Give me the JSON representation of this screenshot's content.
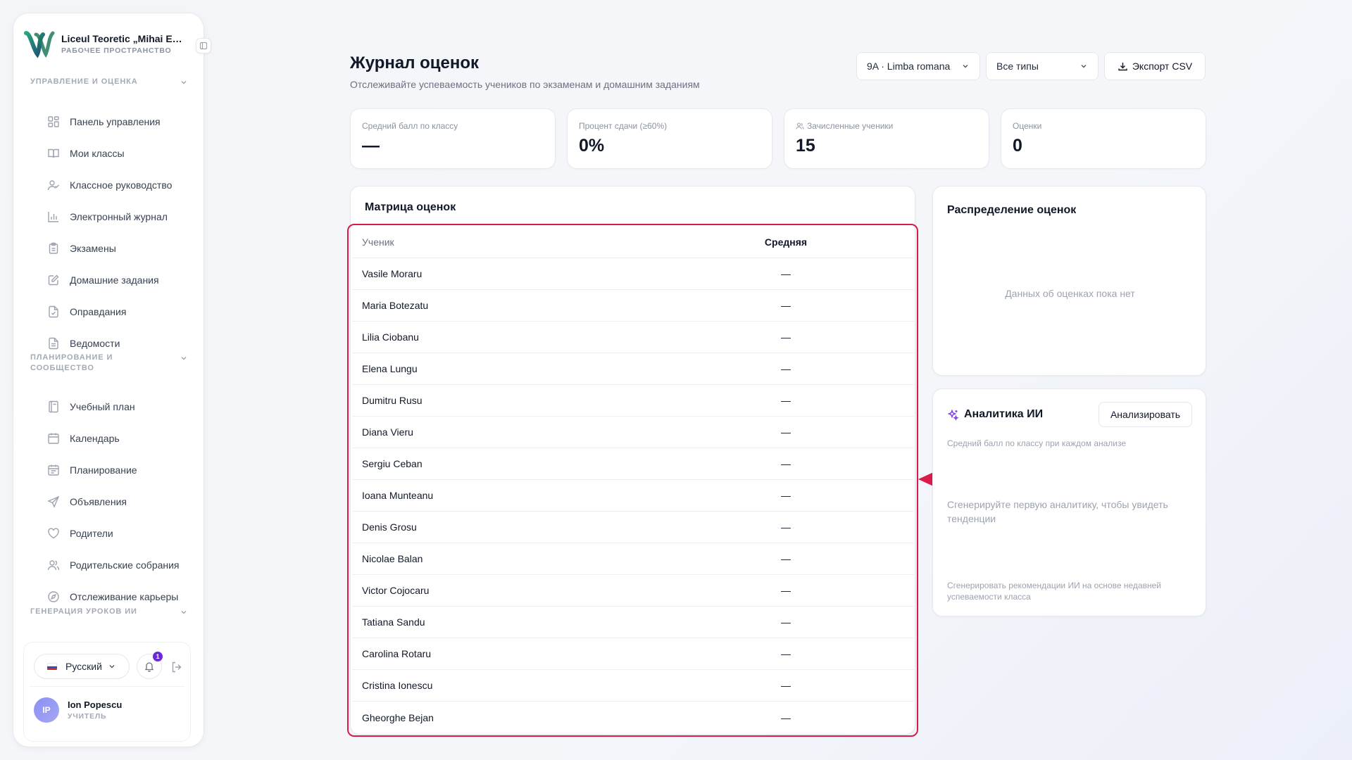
{
  "sidebar": {
    "school_name": "Liceul Teoretic „Mihai Emi...",
    "workspace_label": "РАБОЧЕЕ ПРОСТРАНСТВО",
    "sections": [
      {
        "title": "УПРАВЛЕНИЕ И ОЦЕНКА"
      },
      {
        "title": "ПЛАНИРОВАНИЕ И СООБЩЕСТВО"
      },
      {
        "title": "ГЕНЕРАЦИЯ УРОКОВ ИИ"
      }
    ],
    "items": [
      {
        "label": "Панель управления",
        "icon": "grid-icon"
      },
      {
        "label": "Мои классы",
        "icon": "book-open-icon"
      },
      {
        "label": "Классное руководство",
        "icon": "user-check-icon"
      },
      {
        "label": "Электронный журнал",
        "icon": "bar-chart-icon"
      },
      {
        "label": "Экзамены",
        "icon": "clipboard-icon"
      },
      {
        "label": "Домашние задания",
        "icon": "edit-icon"
      },
      {
        "label": "Оправдания",
        "icon": "file-check-icon"
      },
      {
        "label": "Ведомости",
        "icon": "file-text-icon"
      },
      {
        "label": "Учебный план",
        "icon": "notebook-icon"
      },
      {
        "label": "Календарь",
        "icon": "calendar-icon"
      },
      {
        "label": "Планирование",
        "icon": "calendar-list-icon"
      },
      {
        "label": "Объявления",
        "icon": "send-icon"
      },
      {
        "label": "Родители",
        "icon": "heart-icon"
      },
      {
        "label": "Родительские собрания",
        "icon": "users-icon"
      },
      {
        "label": "Отслеживание карьеры",
        "icon": "compass-icon"
      }
    ],
    "language": "Русский",
    "notifications_count": "1",
    "user": {
      "initials": "IP",
      "name": "Ion Popescu",
      "role": "УЧИТЕЛЬ"
    }
  },
  "header": {
    "title": "Журнал оценок",
    "subtitle": "Отслеживайте успеваемость учеников по экзаменам и домашним заданиям",
    "class_select": "9A · Limba romana",
    "type_select": "Все типы",
    "export_label": "Экспорт CSV"
  },
  "stats": [
    {
      "label": "Средний балл по классу",
      "value": "—"
    },
    {
      "label": "Процент сдачи (≥60%)",
      "value": "0%"
    },
    {
      "label": "Зачисленные ученики",
      "value": "15"
    },
    {
      "label": "Оценки",
      "value": "0"
    }
  ],
  "matrix": {
    "title": "Матрица оценок",
    "columns": {
      "student": "Ученик",
      "average": "Средняя"
    },
    "rows": [
      {
        "student": "Vasile Moraru",
        "average": "—"
      },
      {
        "student": "Maria Botezatu",
        "average": "—"
      },
      {
        "student": "Lilia Ciobanu",
        "average": "—"
      },
      {
        "student": "Elena Lungu",
        "average": "—"
      },
      {
        "student": "Dumitru Rusu",
        "average": "—"
      },
      {
        "student": "Diana Vieru",
        "average": "—"
      },
      {
        "student": "Sergiu Ceban",
        "average": "—"
      },
      {
        "student": "Ioana Munteanu",
        "average": "—"
      },
      {
        "student": "Denis Grosu",
        "average": "—"
      },
      {
        "student": "Nicolae Balan",
        "average": "—"
      },
      {
        "student": "Victor Cojocaru",
        "average": "—"
      },
      {
        "student": "Tatiana Sandu",
        "average": "—"
      },
      {
        "student": "Carolina Rotaru",
        "average": "—"
      },
      {
        "student": "Cristina Ionescu",
        "average": "—"
      },
      {
        "student": "Gheorghe Bejan",
        "average": "—"
      }
    ]
  },
  "distribution": {
    "title": "Распределение оценок",
    "empty": "Данных об оценках пока нет"
  },
  "ai": {
    "title": "Аналитика ИИ",
    "analyze_label": "Анализировать",
    "caption": "Средний балл по классу при каждом анализе",
    "empty": "Сгенерируйте первую аналитику, чтобы увидеть тенденции",
    "footer": "Сгенерировать рекомендации ИИ на основе недавней успеваемости класса"
  },
  "colors": {
    "highlight": "#d81b49",
    "accent": "#6d28d9",
    "logo_green": "#1f7a5c"
  }
}
